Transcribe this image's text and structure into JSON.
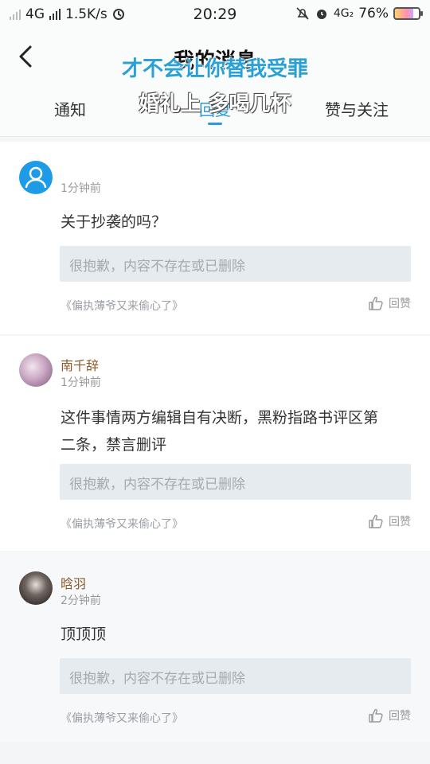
{
  "status_bar": {
    "network": "4G",
    "speed": "1.5K/s",
    "time": "20:29",
    "network2": "4G₂",
    "battery": "76%",
    "battery_level": 0.76
  },
  "header": {
    "title": "我的消息",
    "overlay_line1": "才不会让你替我受罪",
    "overlay_line2": "婚礼上 多喝几杯",
    "tabs": [
      {
        "label": "通知"
      },
      {
        "label": "回复"
      },
      {
        "label": "赞与关注"
      }
    ],
    "active_tab": "回复"
  },
  "messages": [
    {
      "username": "",
      "time": "1分钟前",
      "comment": "关于抄袭的吗？",
      "quote": "很抱歉，内容不存在或已删除",
      "source": "《偏执薄爷又来偷心了》",
      "action": "回赞"
    },
    {
      "username": "南千辞",
      "time": "1分钟前",
      "comment_line1": "这件事情两方编辑自有决断，黑粉指路书评区第",
      "comment_line2": "二条，禁言删评",
      "quote": "很抱歉，内容不存在或已删除",
      "source": "《偏执薄爷又来偷心了》",
      "action": "回赞"
    },
    {
      "username": "晗羽",
      "time": "2分钟前",
      "comment": "顶顶顶",
      "quote": "很抱歉，内容不存在或已删除",
      "source": "《偏执薄爷又来偷心了》",
      "action": "回赞"
    }
  ],
  "colors": {
    "accent": "#2a9bd4",
    "username": "#8a5a2b",
    "quote_bg": "#e5ebef"
  }
}
